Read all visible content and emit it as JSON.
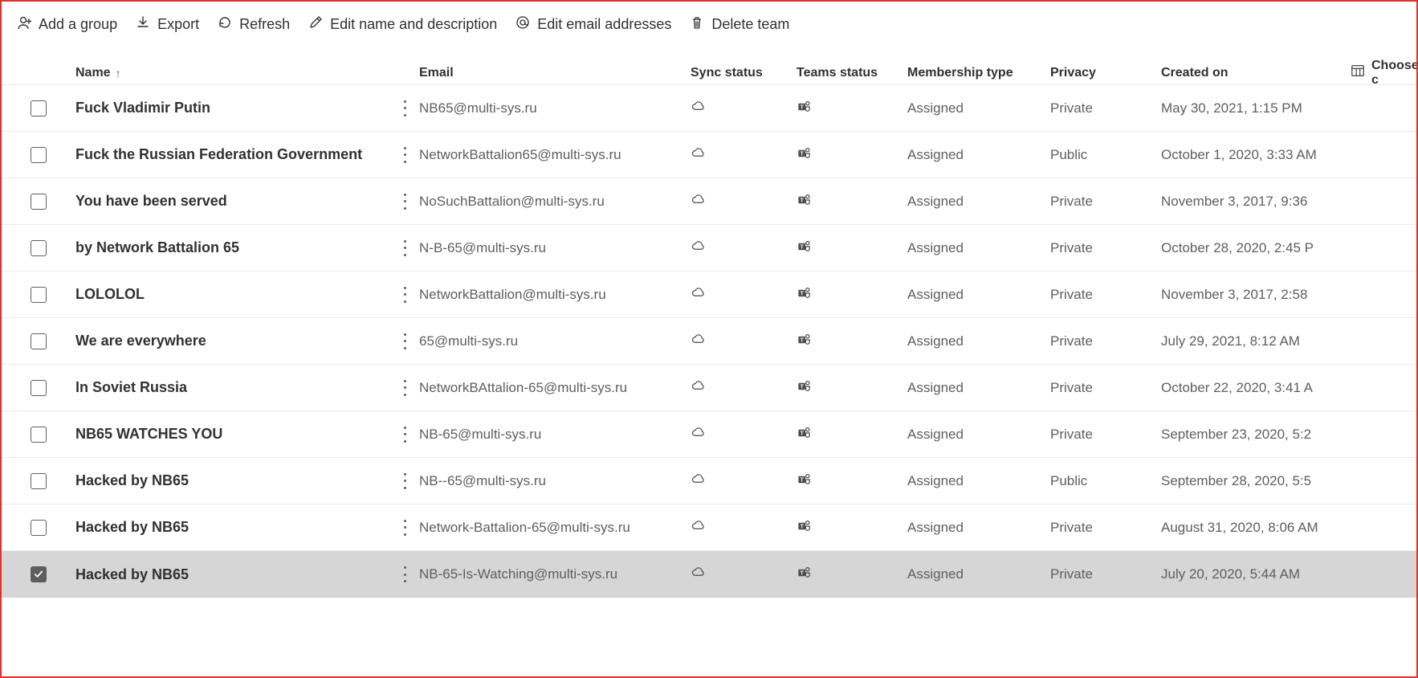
{
  "toolbar": {
    "addGroup": "Add a group",
    "export": "Export",
    "refresh": "Refresh",
    "editName": "Edit name and description",
    "editEmail": "Edit email addresses",
    "deleteTeam": "Delete team"
  },
  "columns": {
    "name": "Name",
    "email": "Email",
    "sync": "Sync status",
    "teams": "Teams status",
    "member": "Membership type",
    "privacy": "Privacy",
    "created": "Created on",
    "choose": "Choose c"
  },
  "rows": [
    {
      "checked": false,
      "name": "Fuck Vladimir Putin",
      "email": "NB65@multi-sys.ru",
      "membership": "Assigned",
      "privacy": "Private",
      "created": "May 30, 2021, 1:15 PM"
    },
    {
      "checked": false,
      "name": "Fuck the Russian Federation Government",
      "email": "NetworkBattalion65@multi-sys.ru",
      "membership": "Assigned",
      "privacy": "Public",
      "created": "October 1, 2020, 3:33 AM"
    },
    {
      "checked": false,
      "name": "You have been served",
      "email": "NoSuchBattalion@multi-sys.ru",
      "membership": "Assigned",
      "privacy": "Private",
      "created": "November 3, 2017, 9:36"
    },
    {
      "checked": false,
      "name": "by Network Battalion 65",
      "email": "N-B-65@multi-sys.ru",
      "membership": "Assigned",
      "privacy": "Private",
      "created": "October 28, 2020, 2:45 P"
    },
    {
      "checked": false,
      "name": "LOLOLOL",
      "email": "NetworkBattalion@multi-sys.ru",
      "membership": "Assigned",
      "privacy": "Private",
      "created": "November 3, 2017, 2:58"
    },
    {
      "checked": false,
      "name": "We are everywhere",
      "email": "65@multi-sys.ru",
      "membership": "Assigned",
      "privacy": "Private",
      "created": "July 29, 2021, 8:12 AM"
    },
    {
      "checked": false,
      "name": "In Soviet Russia",
      "email": "NetworkBAttalion-65@multi-sys.ru",
      "membership": "Assigned",
      "privacy": "Private",
      "created": "October 22, 2020, 3:41 A"
    },
    {
      "checked": false,
      "name": "NB65 WATCHES YOU",
      "email": "NB-65@multi-sys.ru",
      "membership": "Assigned",
      "privacy": "Private",
      "created": "September 23, 2020, 5:2"
    },
    {
      "checked": false,
      "name": "Hacked by NB65",
      "email": "NB--65@multi-sys.ru",
      "membership": "Assigned",
      "privacy": "Public",
      "created": "September 28, 2020, 5:5"
    },
    {
      "checked": false,
      "name": "Hacked by NB65",
      "email": "Network-Battalion-65@multi-sys.ru",
      "membership": "Assigned",
      "privacy": "Private",
      "created": "August 31, 2020, 8:06 AM"
    },
    {
      "checked": true,
      "name": "Hacked by NB65",
      "email": "NB-65-Is-Watching@multi-sys.ru",
      "membership": "Assigned",
      "privacy": "Private",
      "created": "July 20, 2020, 5:44 AM"
    }
  ]
}
